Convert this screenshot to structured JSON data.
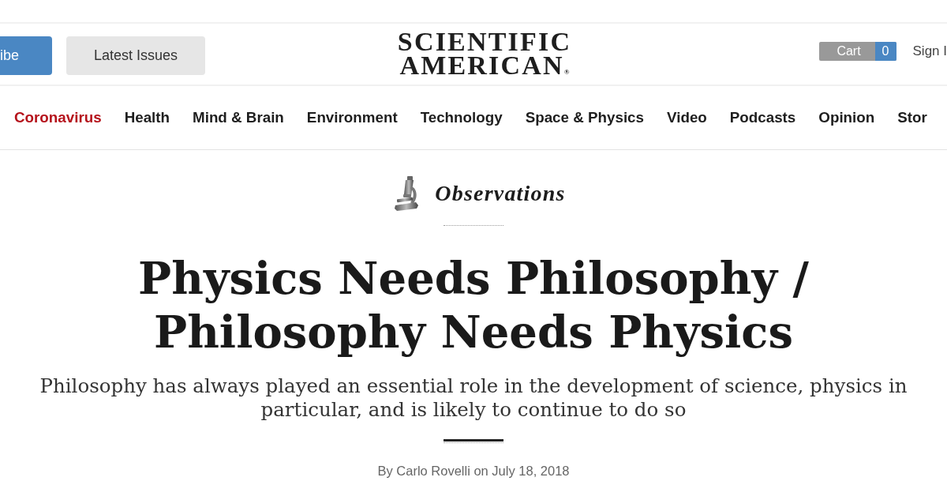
{
  "header": {
    "buttons": [
      {
        "label": "ibe",
        "kind": "primary"
      },
      {
        "label": "Latest Issues",
        "kind": "secondary"
      }
    ],
    "logo": {
      "lines": [
        "SCIENTIFIC",
        "AMERICAN"
      ],
      "mark": "®"
    },
    "cart": {
      "label": "Cart",
      "count": "0"
    },
    "sign_in": "Sign I"
  },
  "nav": {
    "items": [
      {
        "label": "Coronavirus",
        "featured": true
      },
      {
        "label": "Health",
        "featured": false
      },
      {
        "label": "Mind & Brain",
        "featured": false
      },
      {
        "label": "Environment",
        "featured": false
      },
      {
        "label": "Technology",
        "featured": false
      },
      {
        "label": "Space & Physics",
        "featured": false
      },
      {
        "label": "Video",
        "featured": false
      },
      {
        "label": "Podcasts",
        "featured": false
      },
      {
        "label": "Opinion",
        "featured": false
      },
      {
        "label": "Stor",
        "featured": false
      }
    ]
  },
  "blog": {
    "name": "Observations"
  },
  "article": {
    "title": "Physics Needs Philosophy / Philosophy Needs Physics",
    "subtitle": "Philosophy has always played an essential role in the development of science, physics in particular, and is likely to continue to do so",
    "byline": "By Carlo Rovelli on July 18, 2018"
  }
}
